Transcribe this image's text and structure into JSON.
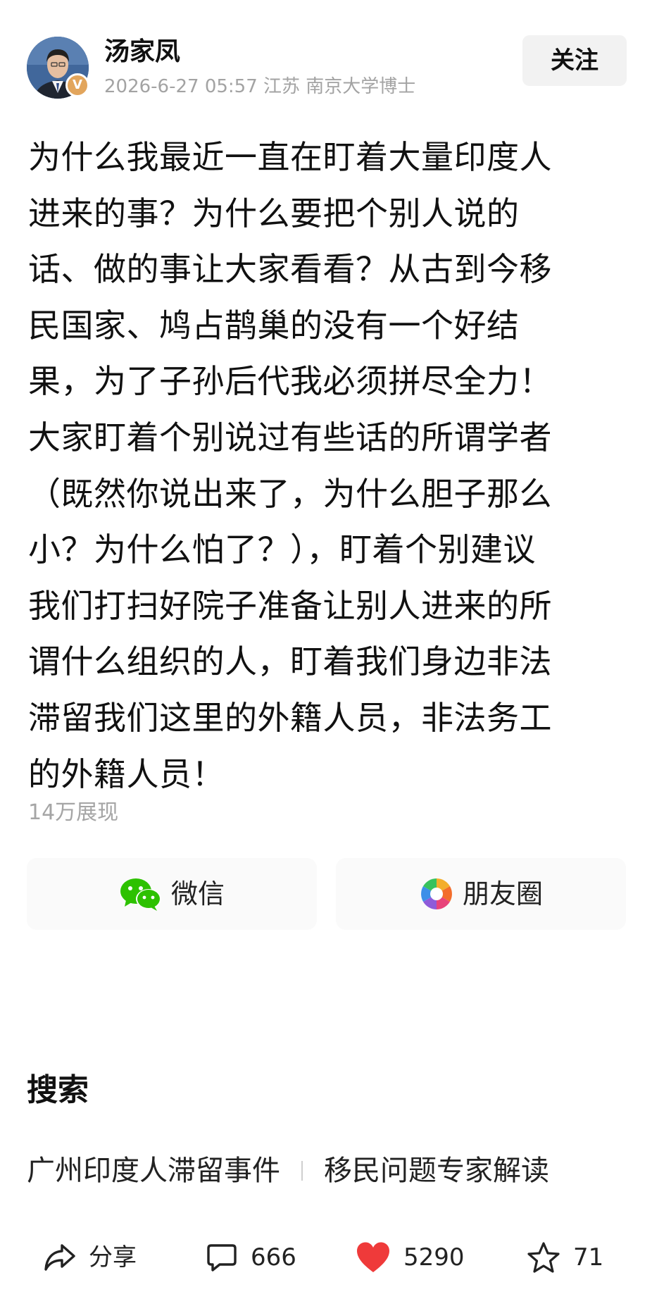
{
  "author": {
    "name": "汤家凤",
    "meta": "2026-6-27 05:57 江苏 南京大学博士",
    "badge": "V"
  },
  "follow_label": "关注",
  "post": {
    "lines": [
      "为什么我最近一直在盯着大量印度人",
      "进来的事？为什么要把个别人说的",
      "话、做的事让大家看看？从古到今移",
      "民国家、鸠占鹊巢的没有一个好结",
      "果，为了子孙后代我必须拼尽全力！",
      "大家盯着个别说过有些话的所谓学者",
      "（既然你说出来了，为什么胆子那么",
      "小？为什么怕了？），盯着个别建议",
      "我们打扫好院子准备让别人进来的所",
      "谓什么组织的人，盯着我们身边非法",
      "滞留我们这里的外籍人员，非法务工",
      "的外籍人员！"
    ],
    "impressions": "14万展现"
  },
  "share": {
    "wechat_label": "微信",
    "moments_label": "朋友圈"
  },
  "search": {
    "title": "搜索",
    "suggestions": [
      "广州印度人滞留事件",
      "移民问题专家解读"
    ]
  },
  "actions": {
    "share_label": "分享",
    "comments": "666",
    "likes": "5290",
    "favorites": "71"
  },
  "colors": {
    "like_heart": "#ef3a3a",
    "wechat_green": "#2dc100",
    "muted_text": "#a3a3a3",
    "verified_badge": "#e2a55c"
  },
  "icons": {
    "wechat": "wechat-icon",
    "moments": "moments-icon",
    "share": "share-arrow-icon",
    "comment": "comment-icon",
    "like": "heart-icon",
    "favorite": "star-icon"
  }
}
